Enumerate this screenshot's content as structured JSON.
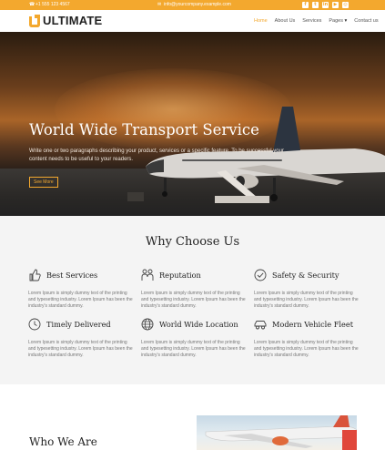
{
  "topbar": {
    "phone": "+1 555 123 4567",
    "email": "info@yourcompany.example.com",
    "social": [
      {
        "icon": "facebook-icon",
        "glyph": "f"
      },
      {
        "icon": "twitter-icon",
        "glyph": "t"
      },
      {
        "icon": "linkedin-icon",
        "glyph": "in"
      },
      {
        "icon": "youtube-icon",
        "glyph": "▶"
      },
      {
        "icon": "instagram-icon",
        "glyph": "◎"
      }
    ]
  },
  "brand": {
    "name": "ULTIMATE"
  },
  "nav": {
    "items": [
      "Home",
      "About Us",
      "Services",
      "Pages",
      "Contact us"
    ],
    "active": "Home",
    "dropdown_indicator": "▾"
  },
  "hero": {
    "title": "World Wide Transport Service",
    "body": "Write one or two paragraphs describing your product, services or a specific feature. To be successful your content needs to be useful to your readers.",
    "button": "See More"
  },
  "why": {
    "title": "Why Choose Us",
    "features": [
      {
        "title": "Best Services",
        "icon": "thumbs-up-icon",
        "text": "Lorem Ipsum is simply dummy text of the printing and typesetting industry. Lorem Ipsum has been the industry's standard dummy."
      },
      {
        "title": "Reputation",
        "icon": "handshake-icon",
        "text": "Lorem Ipsum is simply dummy text of the printing and typesetting industry. Lorem Ipsum has been the industry's standard dummy."
      },
      {
        "title": "Safety & Security",
        "icon": "check-circle-icon",
        "text": "Lorem Ipsum is simply dummy text of the printing and typesetting industry. Lorem Ipsum has been the industry's standard dummy."
      },
      {
        "title": "Timely Delivered",
        "icon": "clock-icon",
        "text": "Lorem Ipsum is simply dummy text of the printing and typesetting industry. Lorem Ipsum has been the industry's standard dummy."
      },
      {
        "title": "World Wide Location",
        "icon": "globe-icon",
        "text": "Lorem Ipsum is simply dummy text of the printing and typesetting industry. Lorem Ipsum has been the industry's standard dummy."
      },
      {
        "title": "Modern Vehicle Fleet",
        "icon": "car-icon",
        "text": "Lorem Ipsum is simply dummy text of the printing and typesetting industry. Lorem Ipsum has been the industry's standard dummy."
      }
    ]
  },
  "who": {
    "title": "Who We Are"
  },
  "colors": {
    "accent": "#f3a82e",
    "section_bg": "#f4f4f4"
  }
}
